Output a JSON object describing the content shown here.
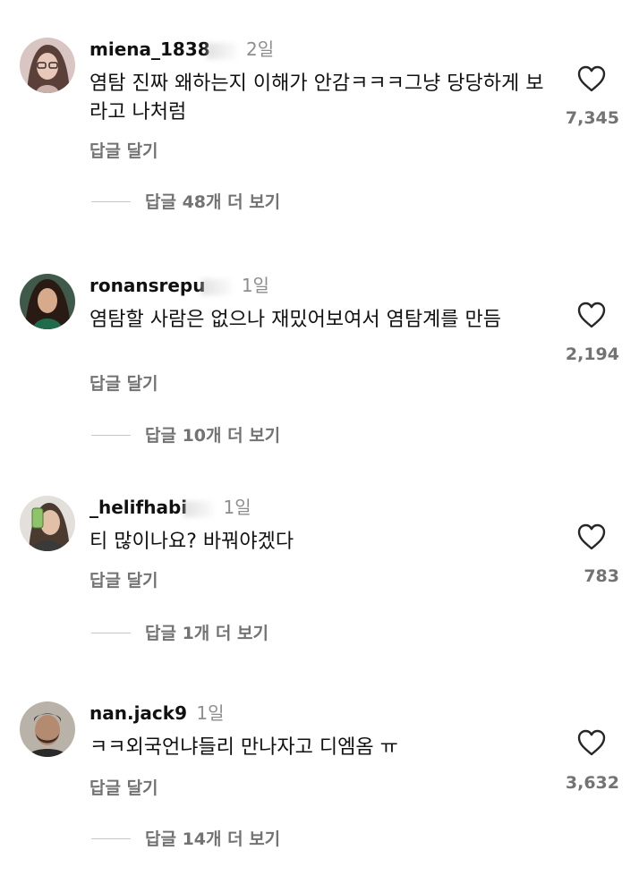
{
  "comments": [
    {
      "username": "miena_1838",
      "time": "2일",
      "text": "염탐 진짜 왜하는지 이해가 안감ㅋㅋㅋ그냥 당당하게 보라고 나처럼",
      "reply_label": "답글 달기",
      "likes": "7,345",
      "view_replies": "답글 48개 더 보기"
    },
    {
      "username": "ronansrepu",
      "time": "1일",
      "text": "염탐할 사람은 없으나 재밌어보여서 염탐계를 만듬",
      "reply_label": "답글 달기",
      "likes": "2,194",
      "view_replies": "답글 10개 더 보기"
    },
    {
      "username": "_helifhabi",
      "time": "1일",
      "text": "티 많이나요? 바꿔야겠다",
      "reply_label": "답글 달기",
      "likes": "783",
      "view_replies": "답글 1개 더 보기"
    },
    {
      "username": "nan.jack9",
      "time": "1일",
      "text": "ㅋㅋ외국언냐들리 만나자고 디엠옴 ㅠ",
      "reply_label": "답글 달기",
      "likes": "3,632",
      "view_replies": "답글 14개 더 보기"
    }
  ],
  "colors": {
    "text": "#111111",
    "secondary": "#737373",
    "timestamp": "#8e8e8e",
    "divider": "#c7c7c7"
  },
  "icons": {
    "like": "heart-outline-icon"
  }
}
